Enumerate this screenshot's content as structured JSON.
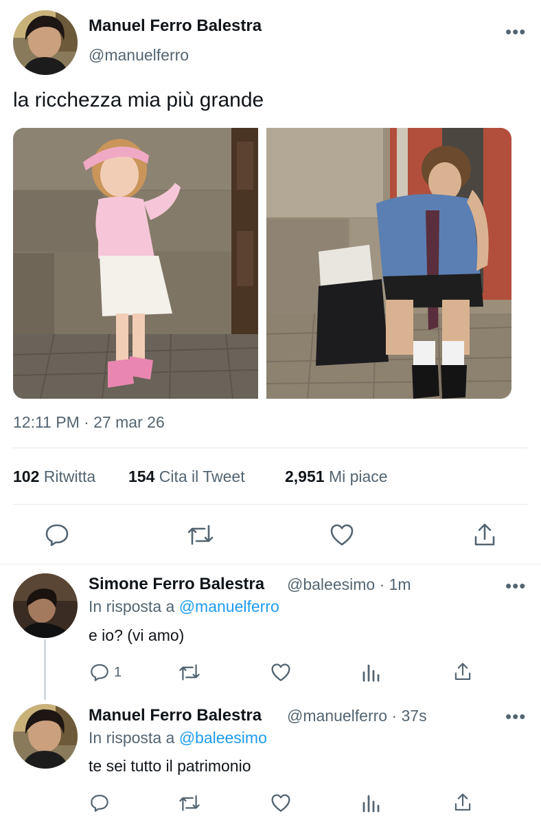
{
  "tweet": {
    "author_name": "Manuel Ferro Balestra",
    "author_handle": "@manuelferro",
    "text": "la ricchezza mia più grande",
    "timestamp": "12:11 PM · 27 mar 26",
    "stats": {
      "retweets_count": "102",
      "retweets_label": "Ritwitta",
      "quotes_count": "154",
      "quotes_label": "Cita il Tweet",
      "likes_count": "2,951",
      "likes_label": "Mi piace"
    },
    "more_label": "•••",
    "actions": [
      "reply-icon",
      "retweet-icon",
      "like-icon",
      "share-icon"
    ]
  },
  "replies": [
    {
      "author_name": "Simone Ferro Balestra",
      "meta": "@baleesimo · 1m",
      "reply_to_label": "In risposta a",
      "reply_to_handle": "@manuelferro",
      "text": "e io? (vi amo)",
      "reply_count": "1",
      "more_label": "•••"
    },
    {
      "author_name": "Manuel Ferro Balestra",
      "meta": "@manuelferro · 37s",
      "reply_to_label": "In risposta a",
      "reply_to_handle": "@baleesimo",
      "text": "te sei tutto il patrimonio",
      "reply_count": "",
      "more_label": "•••"
    }
  ],
  "colors": {
    "text": "#0f1419",
    "secondary": "#536471",
    "accent": "#1d9bf0",
    "divider": "#e6e9eb"
  }
}
